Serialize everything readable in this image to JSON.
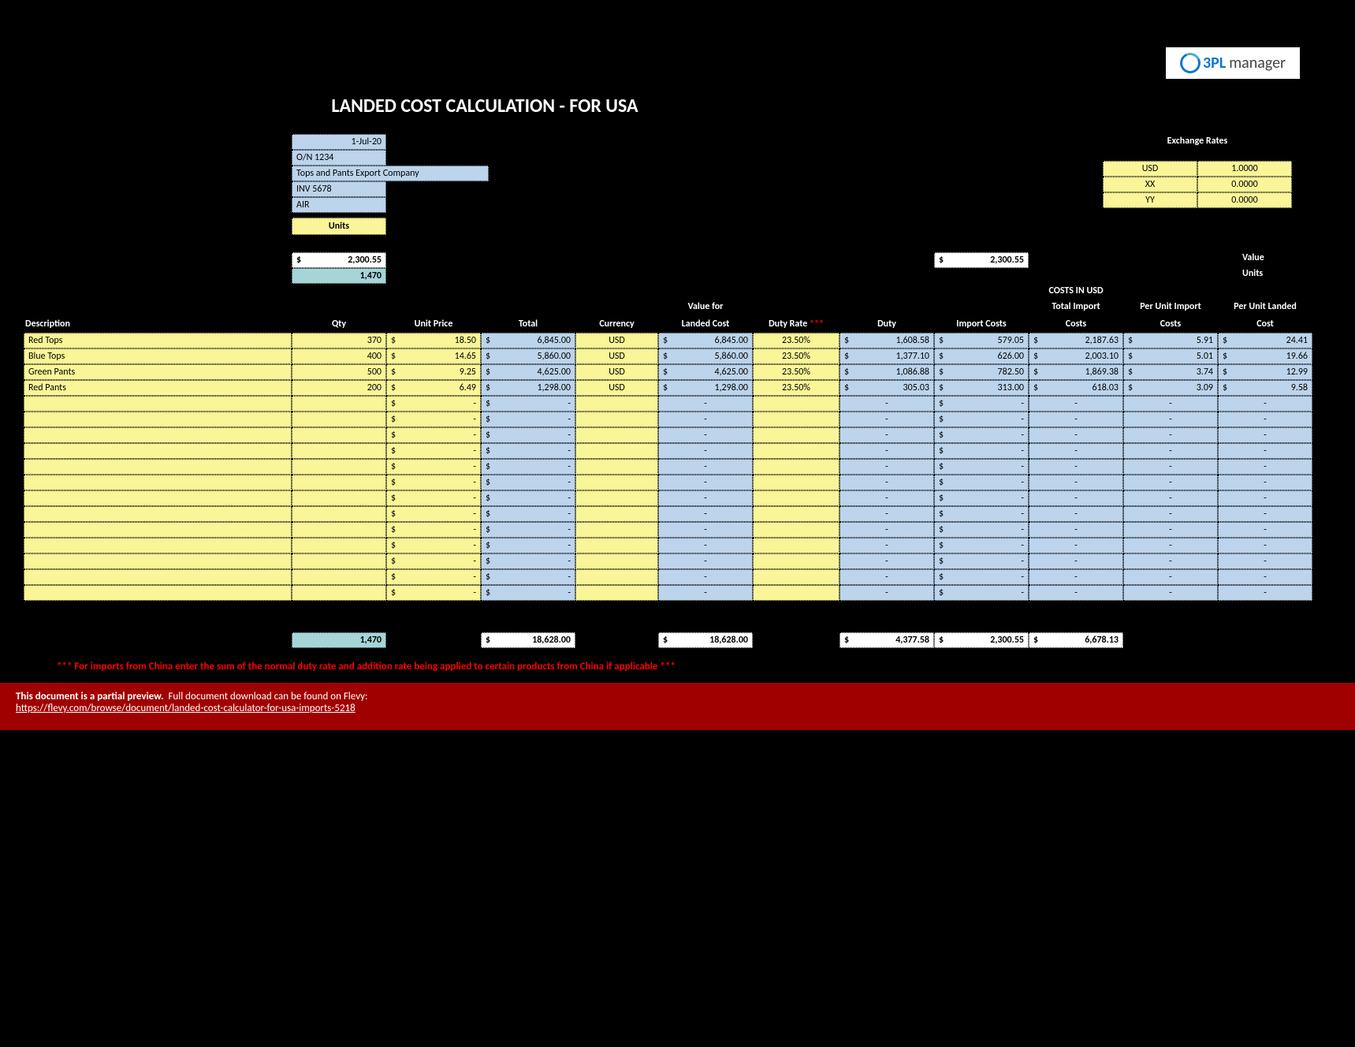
{
  "logo": {
    "brand": "3PL",
    "suffix": "manager"
  },
  "title": "LANDED COST CALCULATION - FOR USA",
  "header": {
    "date": "1-Jul-20",
    "order_no": "O/N 1234",
    "company": "Tops and Pants Export Company",
    "invoice": "INV 5678",
    "mode": "AIR"
  },
  "units_label": "Units",
  "summary": {
    "total_amount": "2,300.55",
    "qty": "1,470",
    "import_costs_total": "2,300.55",
    "value_label": "Value",
    "units_label": "Units"
  },
  "exchange": {
    "title": "Exchange Rates",
    "rows": [
      {
        "code": "USD",
        "rate": "1.0000"
      },
      {
        "code": "XX",
        "rate": "0.0000"
      },
      {
        "code": "YY",
        "rate": "0.0000"
      }
    ]
  },
  "costs_in_usd_label": "COSTS IN USD",
  "columns": {
    "description": "Description",
    "qty": "Qty",
    "unit_price": "Unit Price",
    "total": "Total",
    "currency": "Currency",
    "value_for": "Value for",
    "landed_cost": "Landed Cost",
    "duty_rate": "Duty Rate",
    "duty_rate_stars": "***",
    "duty": "Duty",
    "import_costs": "Import Costs",
    "total_import": "Total Import",
    "costs": "Costs",
    "per_unit_import": "Per Unit Import",
    "per_unit_landed": "Per Unit Landed",
    "cost": "Cost"
  },
  "lines": [
    {
      "desc": "Red Tops",
      "qty": "370",
      "unit_price": "18.50",
      "total": "6,845.00",
      "currency": "USD",
      "vlc": "6,845.00",
      "duty_rate": "23.50%",
      "duty": "1,608.58",
      "import_costs": "579.05",
      "tic": "2,187.63",
      "puic": "5.91",
      "pulc": "24.41"
    },
    {
      "desc": "Blue Tops",
      "qty": "400",
      "unit_price": "14.65",
      "total": "5,860.00",
      "currency": "USD",
      "vlc": "5,860.00",
      "duty_rate": "23.50%",
      "duty": "1,377.10",
      "import_costs": "626.00",
      "tic": "2,003.10",
      "puic": "5.01",
      "pulc": "19.66"
    },
    {
      "desc": "Green Pants",
      "qty": "500",
      "unit_price": "9.25",
      "total": "4,625.00",
      "currency": "USD",
      "vlc": "4,625.00",
      "duty_rate": "23.50%",
      "duty": "1,086.88",
      "import_costs": "782.50",
      "tic": "1,869.38",
      "puic": "3.74",
      "pulc": "12.99"
    },
    {
      "desc": "Red Pants",
      "qty": "200",
      "unit_price": "6.49",
      "total": "1,298.00",
      "currency": "USD",
      "vlc": "1,298.00",
      "duty_rate": "23.50%",
      "duty": "305.03",
      "import_costs": "313.00",
      "tic": "618.03",
      "puic": "3.09",
      "pulc": "9.58"
    }
  ],
  "empty_rows": 13,
  "totals": {
    "qty": "1,470",
    "total": "18,628.00",
    "vlc": "18,628.00",
    "duty": "4,377.58",
    "import_costs": "2,300.55",
    "tic": "6,678.13"
  },
  "note": "*** For imports from China enter the sum of the normal duty rate and addition rate being applied to certain products from China if applicable ***",
  "preview": {
    "line1_bold": "This document is a partial preview.",
    "line1_rest": "Full document download can be found on Flevy:",
    "link": "https://flevy.com/browse/document/landed-cost-calculator-for-usa-imports-5218"
  },
  "dash": "-",
  "dollar": "$"
}
